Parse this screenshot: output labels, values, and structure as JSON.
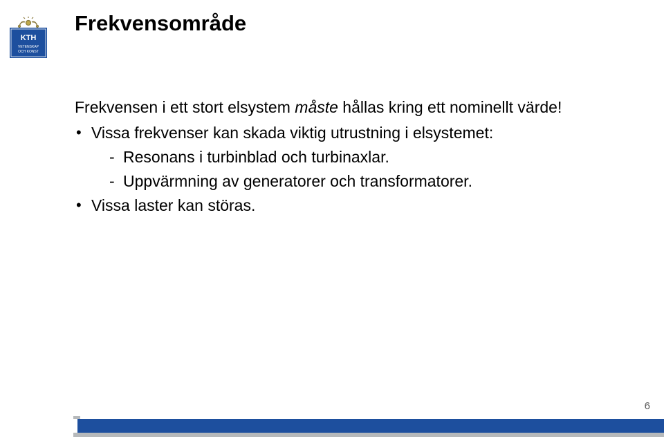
{
  "title": "Frekvensområde",
  "intro_parts": {
    "p1": "Frekvensen i ett stort elsystem ",
    "em": "måste",
    "p2": " hållas kring ett nominellt värde!"
  },
  "bullets": [
    {
      "text": "Vissa frekvenser kan skada viktig utrustning i elsystemet:",
      "sub": [
        "Resonans i turbinblad och turbinaxlar.",
        "Uppvärmning av generatorer och transformatorer."
      ]
    },
    {
      "text": "Vissa laster kan störas.",
      "sub": []
    }
  ],
  "page_number": "6",
  "logo": {
    "top_text": "KTH",
    "bottom_text1": "VETENSKAP",
    "bottom_text2": "OCH KONST"
  }
}
